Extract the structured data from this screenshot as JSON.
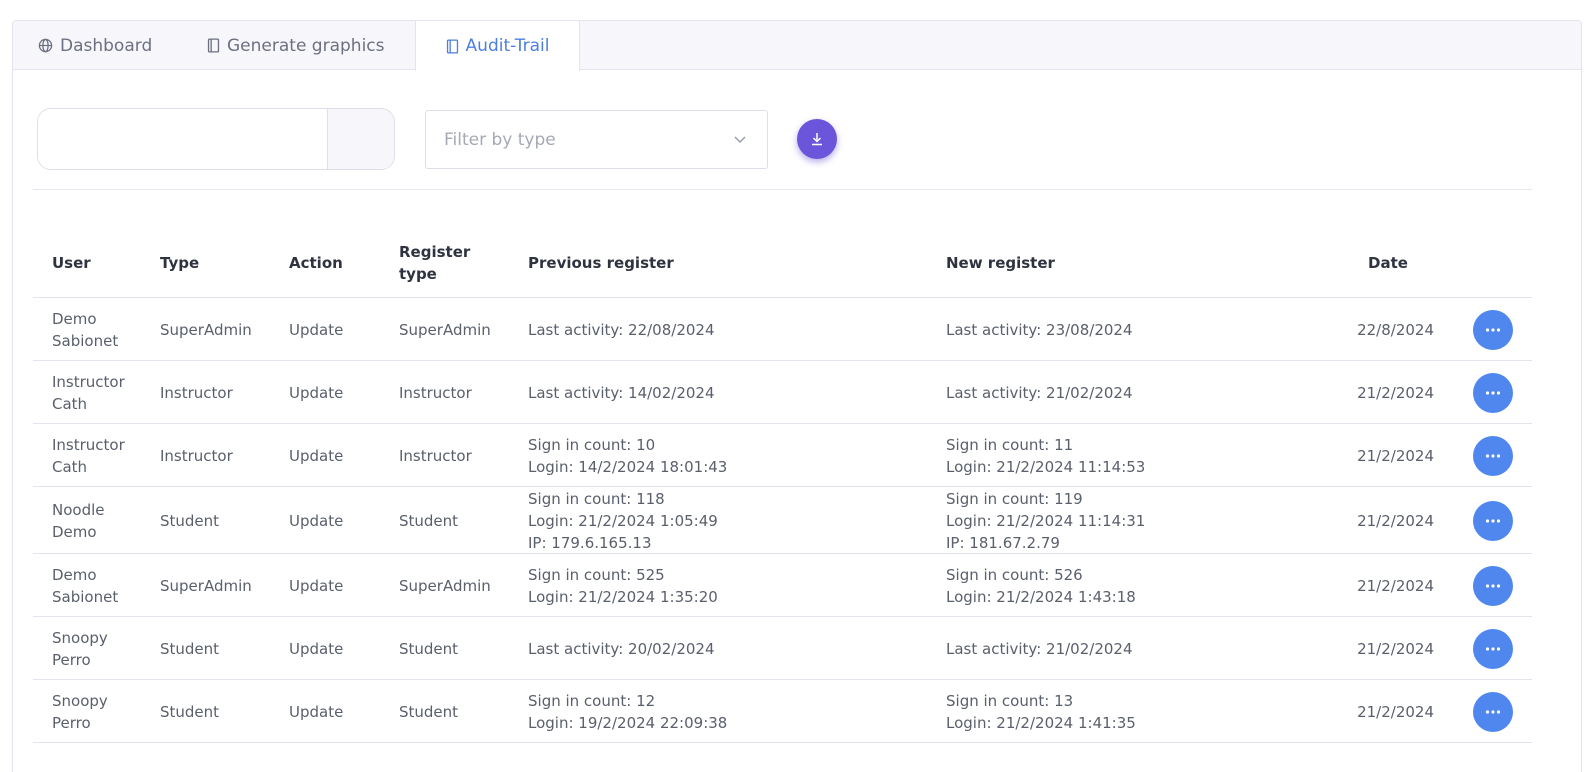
{
  "tabs": [
    {
      "label": "Dashboard",
      "icon": "globe-icon"
    },
    {
      "label": "Generate graphics",
      "icon": "book-icon"
    },
    {
      "label": "Audit-Trail",
      "icon": "book-icon",
      "active": true
    }
  ],
  "search": {
    "value": "",
    "placeholder": ""
  },
  "filter": {
    "placeholder": "Filter by type"
  },
  "download": {
    "icon": "download-icon",
    "color": "#6b55db"
  },
  "table": {
    "headers": {
      "user": "User",
      "type": "Type",
      "action": "Action",
      "register_type_1": "Register",
      "register_type_2": "type",
      "previous": "Previous register",
      "new": "New register",
      "date": "Date"
    },
    "rows": [
      {
        "user": [
          "Demo",
          "Sabionet"
        ],
        "type": "SuperAdmin",
        "action": "Update",
        "register_type": "SuperAdmin",
        "previous": [
          "Last activity: 22/08/2024"
        ],
        "new": [
          "Last activity: 23/08/2024"
        ],
        "date": "22/8/2024"
      },
      {
        "user": [
          "Instructor",
          "Cath"
        ],
        "type": "Instructor",
        "action": "Update",
        "register_type": "Instructor",
        "previous": [
          "Last activity: 14/02/2024"
        ],
        "new": [
          "Last activity: 21/02/2024"
        ],
        "date": "21/2/2024"
      },
      {
        "user": [
          "Instructor",
          "Cath"
        ],
        "type": "Instructor",
        "action": "Update",
        "register_type": "Instructor",
        "previous": [
          "Sign in count: 10",
          "Login: 14/2/2024 18:01:43"
        ],
        "new": [
          "Sign in count: 11",
          "Login: 21/2/2024 11:14:53"
        ],
        "date": "21/2/2024"
      },
      {
        "user": [
          "Noodle",
          "Demo"
        ],
        "type": "Student",
        "action": "Update",
        "register_type": "Student",
        "previous": [
          "Sign in count: 118",
          "Login: 21/2/2024 1:05:49",
          "IP: 179.6.165.13"
        ],
        "new": [
          "Sign in count: 119",
          "Login: 21/2/2024 11:14:31",
          "IP: 181.67.2.79"
        ],
        "date": "21/2/2024"
      },
      {
        "user": [
          "Demo",
          "Sabionet"
        ],
        "type": "SuperAdmin",
        "action": "Update",
        "register_type": "SuperAdmin",
        "previous": [
          "Sign in count: 525",
          "Login: 21/2/2024 1:35:20"
        ],
        "new": [
          "Sign in count: 526",
          "Login: 21/2/2024 1:43:18"
        ],
        "date": "21/2/2024"
      },
      {
        "user": [
          "Snoopy",
          "Perro"
        ],
        "type": "Student",
        "action": "Update",
        "register_type": "Student",
        "previous": [
          "Last activity: 20/02/2024"
        ],
        "new": [
          "Last activity: 21/02/2024"
        ],
        "date": "21/2/2024"
      },
      {
        "user": [
          "Snoopy",
          "Perro"
        ],
        "type": "Student",
        "action": "Update",
        "register_type": "Student",
        "previous": [
          "Sign in count: 12",
          "Login: 19/2/2024 22:09:38"
        ],
        "new": [
          "Sign in count: 13",
          "Login: 21/2/2024 1:41:35"
        ],
        "date": "21/2/2024"
      }
    ]
  },
  "colors": {
    "accent": "#4c7fe0",
    "more_button": "#4f87ee"
  }
}
